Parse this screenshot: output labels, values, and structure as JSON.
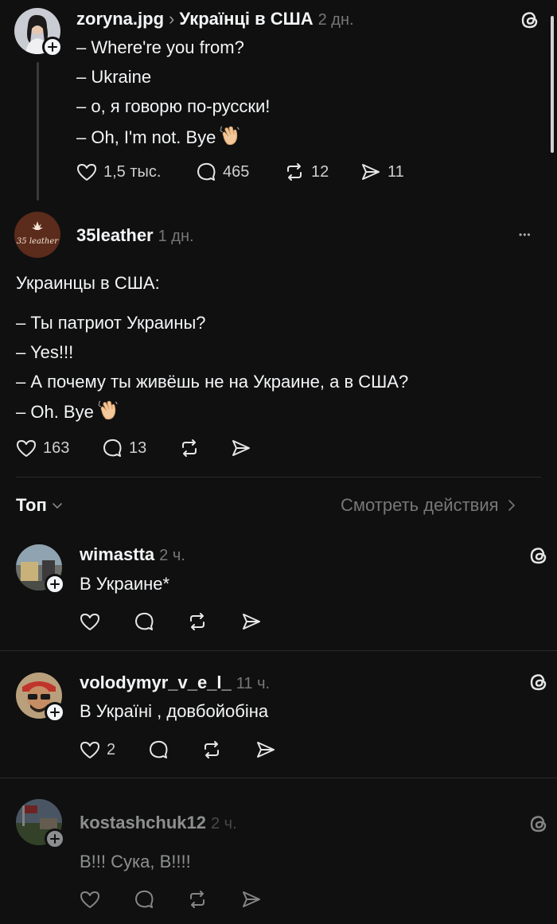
{
  "post1": {
    "username": "zoryna.jpg",
    "breadcrumb_sep": "›",
    "topic": "Українці в США",
    "time": "2 дн.",
    "lines": [
      "– Where're you from?",
      "– Ukraine",
      "– о, я говорю по-русски!",
      "– Oh, I'm not. Bye"
    ],
    "likes": "1,5 тыс.",
    "replies": "465",
    "reposts": "12",
    "shares": "11"
  },
  "post2": {
    "username": "35leather",
    "avatar_text": "35 leather",
    "time": "1 дн.",
    "more": "•••",
    "title": "Украинцы в США:",
    "lines": [
      "– Ты патриот Украины?",
      "– Yes!!!",
      "– А почему ты живёшь не на Украине, а в США?",
      "– Oh. Bye"
    ],
    "likes": "163",
    "replies": "13"
  },
  "sort": {
    "label": "Топ",
    "view_activity": "Смотреть действия"
  },
  "comments": [
    {
      "username": "wimastta",
      "time": "2 ч.",
      "text": "В Украине*",
      "likes": ""
    },
    {
      "username": "volodymyr_v_e_l_",
      "time": "11 ч.",
      "text": "В Україні , довбойобіна",
      "likes": "2"
    },
    {
      "username": "kostashchuk12",
      "time": "2 ч.",
      "text": "В!!! Сука, В!!!!",
      "likes": ""
    }
  ],
  "icons": {
    "wave": "waving-hand-icon",
    "like": "heart-icon",
    "reply": "comment-icon",
    "repost": "repost-icon",
    "share": "send-icon",
    "threads": "threads-logo-icon"
  },
  "colors": {
    "background": "#101010",
    "text": "#f3f5f7",
    "muted": "#777777",
    "separator": "#2a2a2a"
  }
}
